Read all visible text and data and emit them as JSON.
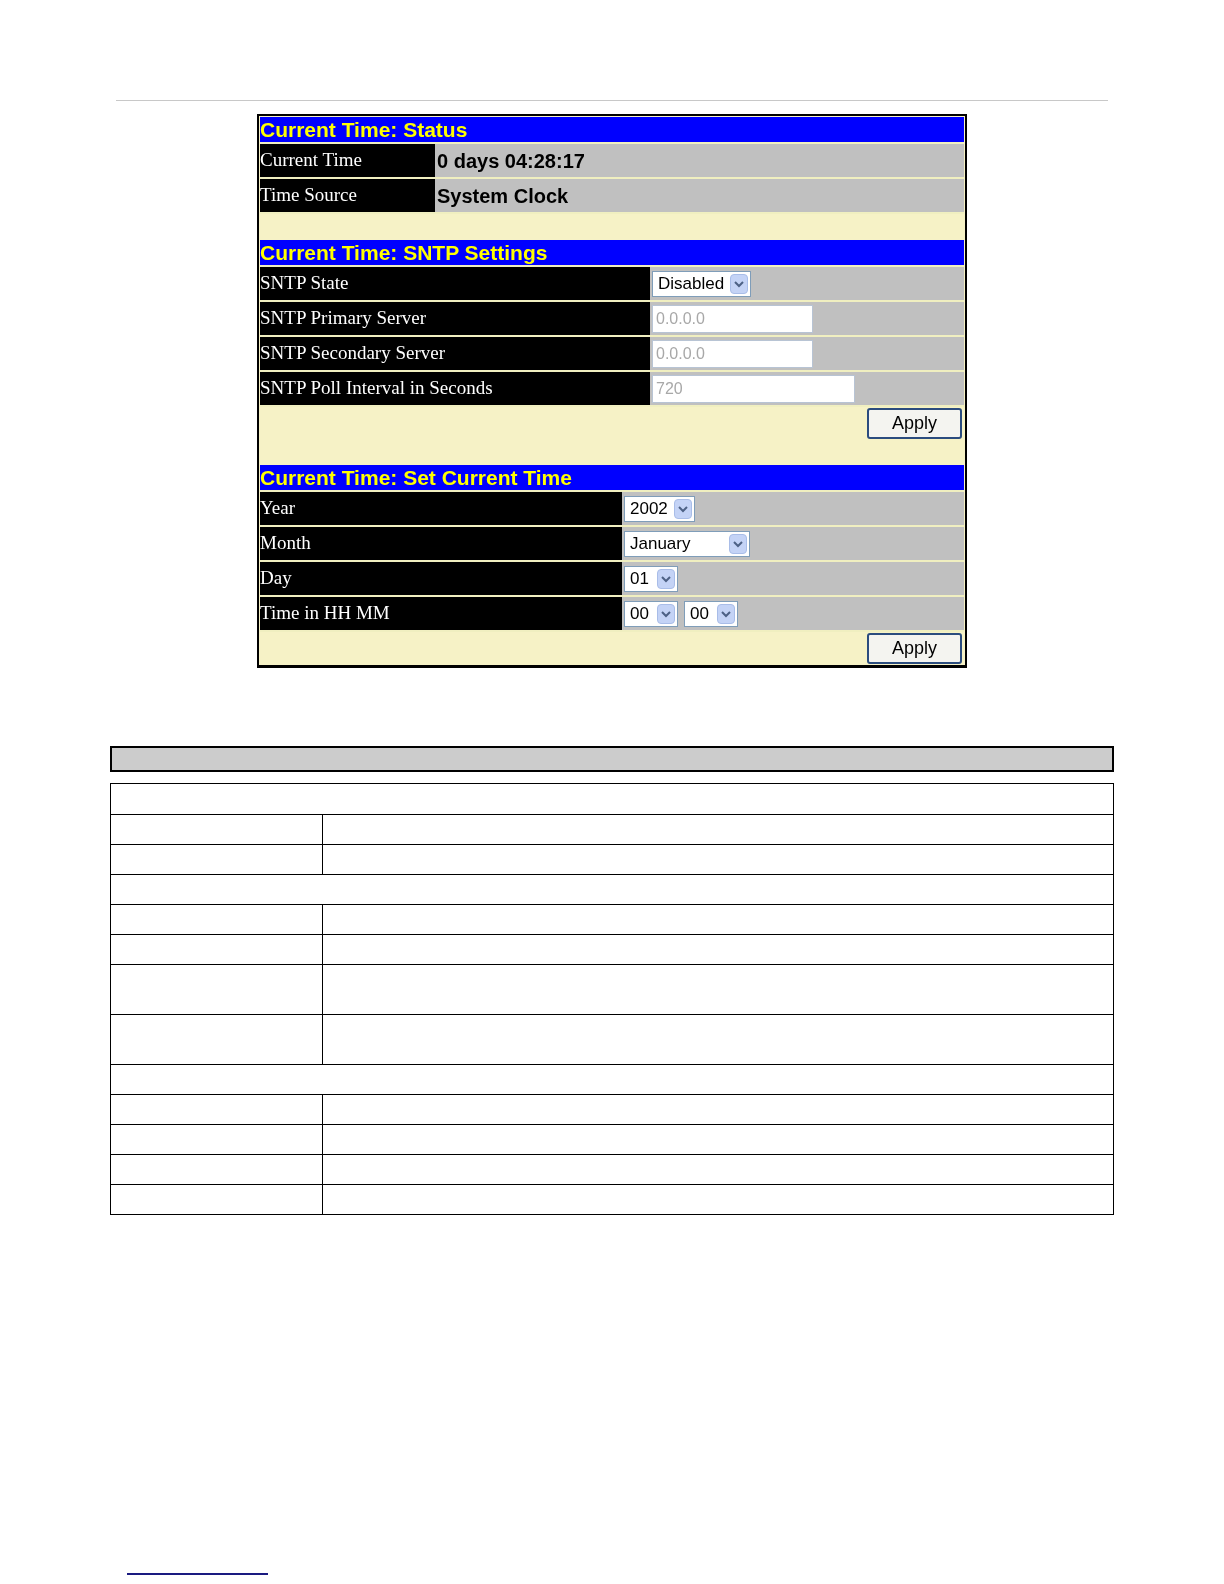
{
  "panel": {
    "sections": [
      {
        "title": "Current Time: Status",
        "rows": [
          {
            "kind": "text",
            "label": "Current Time",
            "value": "0 days 04:28:17"
          },
          {
            "kind": "text",
            "label": "Time Source",
            "value": "System Clock"
          }
        ]
      },
      {
        "title": "Current Time: SNTP Settings",
        "rows": [
          {
            "kind": "select",
            "label": "SNTP State",
            "values": [
              "Disabled"
            ]
          },
          {
            "kind": "input",
            "label": "SNTP Primary Server",
            "value": "0.0.0.0",
            "disabled": true
          },
          {
            "kind": "input",
            "label": "SNTP Secondary Server",
            "value": "0.0.0.0",
            "disabled": true
          },
          {
            "kind": "input",
            "label": "SNTP Poll Interval in Seconds",
            "value": "720",
            "disabled": true,
            "wide": true
          }
        ],
        "button": "Apply"
      },
      {
        "title": "Current Time: Set Current Time",
        "rows": [
          {
            "kind": "select",
            "label": "Year",
            "values": [
              "2002"
            ]
          },
          {
            "kind": "select",
            "label": "Month",
            "values": [
              "January"
            ],
            "wide": true
          },
          {
            "kind": "select",
            "label": "Day",
            "values": [
              "01"
            ]
          },
          {
            "kind": "select",
            "label": "Time in HH MM",
            "values": [
              "00",
              "00"
            ]
          }
        ],
        "button": "Apply"
      }
    ]
  },
  "description_table": {
    "rows": [
      {
        "kind": "section"
      },
      {
        "kind": "pair"
      },
      {
        "kind": "pair"
      },
      {
        "kind": "section"
      },
      {
        "kind": "pair"
      },
      {
        "kind": "pair"
      },
      {
        "kind": "tall_pair"
      },
      {
        "kind": "tall_pair"
      },
      {
        "kind": "section"
      },
      {
        "kind": "pair"
      },
      {
        "kind": "pair"
      },
      {
        "kind": "pair"
      },
      {
        "kind": "pair"
      }
    ]
  }
}
